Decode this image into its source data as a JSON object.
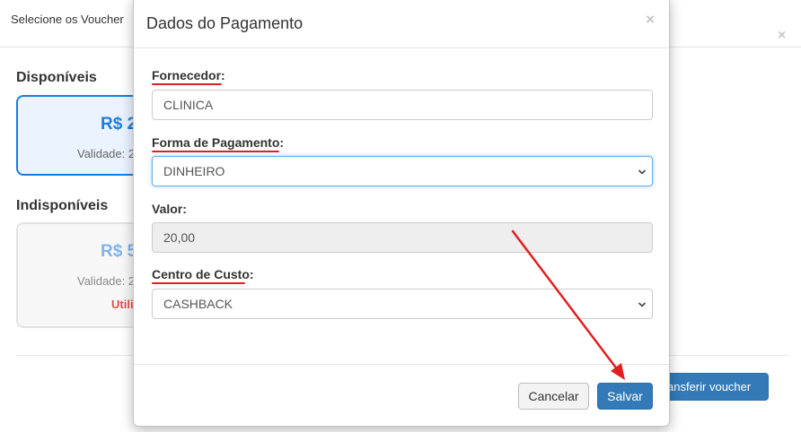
{
  "background_dialog": {
    "title": "Selecione os Voucher",
    "close_glyph": "×",
    "available_section": "Disponíveis",
    "unavailable_section": "Indisponíveis",
    "available_voucher": {
      "amount": "R$ 2",
      "validity": "Validade: 2"
    },
    "unavailable_voucher": {
      "amount": "R$ 5",
      "validity": "Validade: 2",
      "status": "Utili"
    },
    "transfer_button": "ansferir voucher"
  },
  "modal": {
    "title": "Dados do Pagamento",
    "close_glyph": "×",
    "fields": {
      "supplier": {
        "label": "Fornecedor:",
        "value": "CLINICA"
      },
      "payment_method": {
        "label": "Forma de Pagamento:",
        "value": "DINHEIRO"
      },
      "amount": {
        "label": "Valor:",
        "value": "20,00"
      },
      "cost_center": {
        "label": "Centro de Custo:",
        "value": "CASHBACK"
      }
    },
    "buttons": {
      "cancel": "Cancelar",
      "save": "Salvar"
    }
  },
  "colors": {
    "primary": "#337ab7",
    "accent_blue": "#1a7ee0",
    "annotation_red": "#e02020",
    "danger_text": "#d9534f"
  },
  "icons": {
    "modal_close": "close-icon",
    "select_arrow": "chevron-down-icon"
  }
}
